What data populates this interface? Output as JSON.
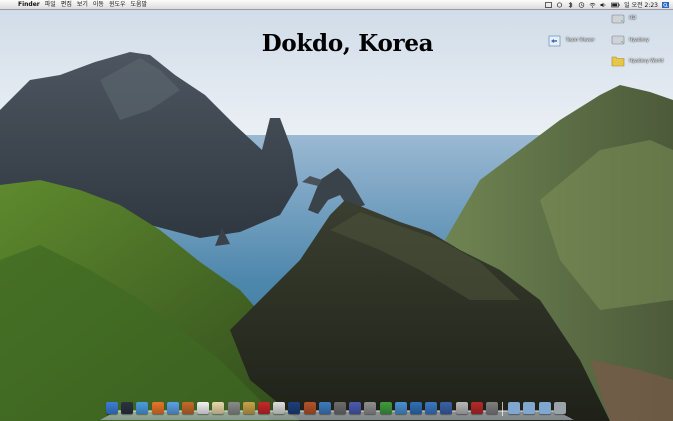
{
  "menubar": {
    "apple_symbol": "",
    "items": [
      "Finder",
      "파일",
      "편집",
      "보기",
      "이동",
      "윈도우",
      "도움말"
    ],
    "clock": "일 오전 2:23"
  },
  "wallpaper_text": "Dokdo, Korea",
  "desktop_icons": [
    {
      "label": "HD",
      "icon": "hard-drive-icon"
    },
    {
      "label": "Team Viewer",
      "icon": "teamviewer-icon"
    },
    {
      "label": "Hyadeny",
      "icon": "hard-drive-icon"
    },
    {
      "label": "Hyadeny World",
      "icon": "folder-icon"
    }
  ],
  "dock": {
    "apps": [
      {
        "name": "finder-icon",
        "color": "#3b7fd6"
      },
      {
        "name": "dashboard-icon",
        "color": "#2a3340"
      },
      {
        "name": "safari-icon",
        "color": "#4a9de0"
      },
      {
        "name": "firefox-icon",
        "color": "#e8752a"
      },
      {
        "name": "itunes-icon",
        "color": "#5aa0e8"
      },
      {
        "name": "photo-icon",
        "color": "#c46a2a"
      },
      {
        "name": "ical-icon",
        "color": "#f2f2f2"
      },
      {
        "name": "preview-icon",
        "color": "#e7d9a8"
      },
      {
        "name": "system-preferences-icon",
        "color": "#8a8a8a"
      },
      {
        "name": "pencil-icon",
        "color": "#c8a24a"
      },
      {
        "name": "pdf-icon",
        "color": "#c62828"
      },
      {
        "name": "document-icon",
        "color": "#dedede"
      },
      {
        "name": "photoshop-icon",
        "color": "#1c3f7a"
      },
      {
        "name": "bridge-icon",
        "color": "#b4532a"
      },
      {
        "name": "app-icon",
        "color": "#3e7bbf"
      },
      {
        "name": "script-icon",
        "color": "#6d6d6d"
      },
      {
        "name": "palette-icon",
        "color": "#4b5bb0"
      },
      {
        "name": "tools-icon",
        "color": "#8e8e8e"
      },
      {
        "name": "chat-icon",
        "color": "#3f9b3f"
      },
      {
        "name": "time-machine-icon",
        "color": "#4a8fd0"
      },
      {
        "name": "globe-icon",
        "color": "#2f6fb8"
      },
      {
        "name": "app-store-icon",
        "color": "#3b78c4"
      },
      {
        "name": "calendar-icon",
        "color": "#3a62a8"
      },
      {
        "name": "cd-icon",
        "color": "#b8b8b8"
      },
      {
        "name": "activity-icon",
        "color": "#b52a2a"
      },
      {
        "name": "utility-icon",
        "color": "#7e7e7e"
      }
    ],
    "stacks": [
      {
        "name": "applications-folder-icon",
        "color": "#7fa7d0"
      },
      {
        "name": "documents-folder-icon",
        "color": "#7fa7d0"
      },
      {
        "name": "downloads-folder-icon",
        "color": "#7fa7d0"
      },
      {
        "name": "trash-icon",
        "color": "#9aa2aa"
      }
    ]
  }
}
